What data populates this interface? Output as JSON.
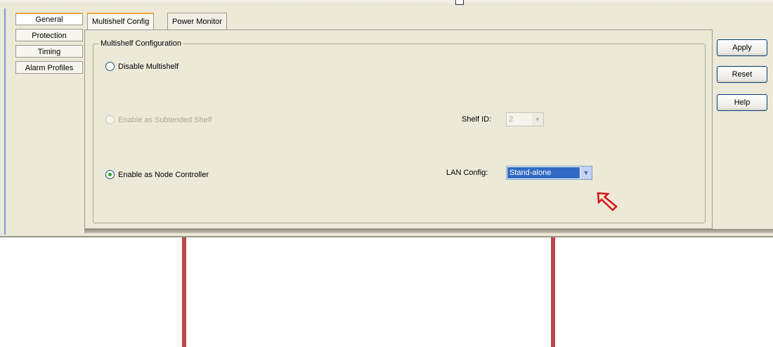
{
  "sidebar_tabs": [
    {
      "label": "General",
      "active": true
    },
    {
      "label": "Protection",
      "active": false
    },
    {
      "label": "Timing",
      "active": false
    },
    {
      "label": "Alarm Profiles",
      "active": false
    }
  ],
  "tabs": [
    {
      "label": "Multishelf Config",
      "active": true
    },
    {
      "label": "Power Monitor",
      "active": false
    }
  ],
  "group": {
    "title": "Multishelf Configuration",
    "disable_option": {
      "label": "Disable Multishelf",
      "checked": false
    },
    "subtended_option": {
      "label": "Enable as Subtended Shelf",
      "checked": false,
      "enabled": false
    },
    "node_controller_option": {
      "label": "Enable as Node Controller",
      "checked": true
    },
    "shelf_id": {
      "label": "Shelf ID:",
      "value": "2",
      "enabled": false
    },
    "lan_config": {
      "label": "LAN Config:",
      "value": "Stand-alone"
    }
  },
  "buttons": {
    "apply": "Apply",
    "reset": "Reset",
    "help": "Help"
  },
  "colors": {
    "pointer_arrow": "#d9141b",
    "annotation_lines": "#b9484d",
    "selection": "#316ac5"
  },
  "icons": {
    "pointer": "outlined-arrow-icon"
  }
}
